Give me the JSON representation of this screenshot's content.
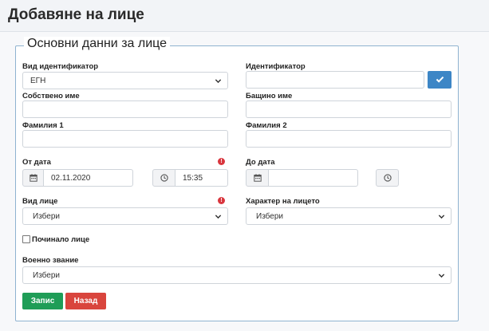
{
  "page": {
    "title": "Добавяне на лице"
  },
  "form": {
    "legend": "Основни данни за лице",
    "id_type": {
      "label": "Вид идентификатор",
      "value": "ЕГН"
    },
    "identifier": {
      "label": "Идентификатор",
      "value": ""
    },
    "first_name": {
      "label": "Собствено име",
      "value": ""
    },
    "father_name": {
      "label": "Бащино име",
      "value": ""
    },
    "family_1": {
      "label": "Фамилия 1",
      "value": ""
    },
    "family_2": {
      "label": "Фамилия 2",
      "value": ""
    },
    "from_date": {
      "label": "От дата",
      "date": "02.11.2020",
      "time": "15:35"
    },
    "to_date": {
      "label": "До дата",
      "date": "",
      "time": ""
    },
    "person_type": {
      "label": "Вид лице",
      "value": "Избери"
    },
    "person_character": {
      "label": "Характер на лицето",
      "value": "Избери"
    },
    "deceased": {
      "label": "Починало лице",
      "checked": false
    },
    "military_rank": {
      "label": "Военно звание",
      "value": "Избери"
    },
    "save_label": "Запис",
    "back_label": "Назад"
  },
  "colors": {
    "save": "#1f9d57",
    "back": "#d9453d",
    "check_button": "#3d86c6",
    "required": "#d9363e"
  },
  "icons": {
    "required": "!",
    "check": "check-icon",
    "calendar": "calendar-icon",
    "clock": "clock-icon",
    "chevron": "chevron-down-icon"
  }
}
